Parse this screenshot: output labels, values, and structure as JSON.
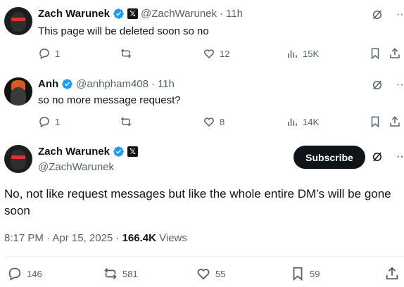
{
  "replies": [
    {
      "name": "Zach Warunek",
      "handle": "@ZachWarunek",
      "separator": "·",
      "time": "11h",
      "text": "This page will be deleted soon so no",
      "replies_count": "1",
      "reposts_count": "",
      "likes_count": "12",
      "views_count": "15K"
    },
    {
      "name": "Anh",
      "handle": "@anhpham408",
      "separator": "·",
      "time": "11h",
      "text": "so no more message request?",
      "replies_count": "1",
      "reposts_count": "",
      "likes_count": "8",
      "views_count": "14K"
    }
  ],
  "main_post": {
    "name": "Zach Warunek",
    "handle": "@ZachWarunek",
    "subscribe_label": "Subscribe",
    "text": "No, not like request messages but like the whole entire DM’s will be gone soon",
    "timestamp": "8:17 PM · Apr 15, 2025 · ",
    "views_count": "166.4K",
    "views_label": " Views",
    "replies_count": "146",
    "reposts_count": "581",
    "likes_count": "55",
    "bookmarks_count": "59"
  },
  "colors": {
    "verified": "#1d9bf0",
    "text_primary": "#0f1419",
    "text_secondary": "#536471",
    "subscribe_bg": "#0f1419"
  }
}
